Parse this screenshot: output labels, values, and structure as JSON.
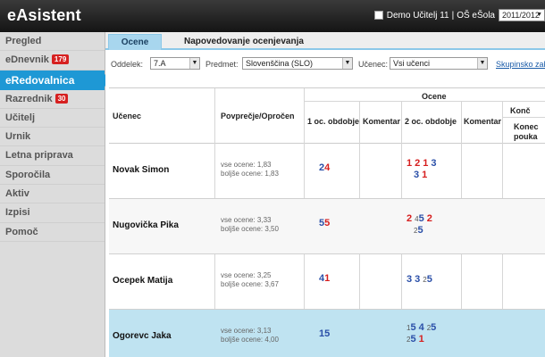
{
  "app": {
    "title": "eAsistent"
  },
  "topbar": {
    "user": "Demo Učitelj 11",
    "separator": "|",
    "school": "OŠ eŠola",
    "year": "2011/2012"
  },
  "sidebar": {
    "items": [
      {
        "label": "Pregled"
      },
      {
        "label": "eDnevnik",
        "badge": "179"
      },
      {
        "label": "eRedovalnica",
        "active": true
      },
      {
        "label": "Razrednik",
        "badge": "30"
      },
      {
        "label": "Učitelj"
      },
      {
        "label": "Urnik"
      },
      {
        "label": "Letna priprava"
      },
      {
        "label": "Sporočila"
      },
      {
        "label": "Aktiv"
      },
      {
        "label": "Izpisi"
      },
      {
        "label": "Pomoč"
      }
    ]
  },
  "tabs": [
    {
      "label": "Ocene"
    },
    {
      "label": "Napovedovanje ocenjevanja"
    }
  ],
  "filters": {
    "oddelek_label": "Oddelek:",
    "oddelek_value": "7.A",
    "predmet_label": "Predmet:",
    "predmet_value": "Slovenščina (SLO)",
    "ucenec_label": "Učenec:",
    "ucenec_value": "Vsi učenci",
    "link": "Skupinsko zak"
  },
  "table": {
    "headers": {
      "student": "Učenec",
      "average": "Povprečje/Opročen",
      "grades": "Ocene",
      "period1": "1 oc. obdobje",
      "comment1": "Komentar",
      "period2": "2 oc. obdobje",
      "comment2": "Komentar",
      "final": "Konč",
      "final_sub": "Konec pouka"
    },
    "rows": [
      {
        "name": "Novak Simon",
        "avg_all": "vse ocene: 1,83",
        "avg_best": "boljše ocene: 1,83"
      },
      {
        "name": "Nugovička Pika",
        "avg_all": "vse ocene: 3,33",
        "avg_best": "boljše ocene: 3,50"
      },
      {
        "name": "Ocepek Matija",
        "avg_all": "vse ocene: 3,25",
        "avg_best": "boljše ocene: 3,67"
      },
      {
        "name": "Ogorevc Jaka",
        "avg_all": "vse ocene: 3,13",
        "avg_best": "boljše ocene: 4,00"
      }
    ]
  },
  "grades": {
    "r0_p1": [
      "2",
      "4"
    ],
    "r0_p2_line1": [
      "1",
      "2",
      "1",
      "3"
    ],
    "r0_p2_line2": [
      "3",
      "1"
    ],
    "r1_p1": [
      "5",
      "5"
    ],
    "r1_p2_line1": [
      "2",
      "4",
      "5",
      "2"
    ],
    "r1_p2_line2": [
      "2",
      "5"
    ],
    "r2_p1": [
      "4",
      "1"
    ],
    "r2_p2_line1": [
      "3",
      "3",
      "2",
      "5"
    ],
    "r3_p1": [
      "1",
      "5"
    ],
    "r3_p2_line1": [
      "1",
      "5",
      "4",
      "2",
      "5"
    ],
    "r3_p2_line2": [
      "2",
      "5",
      "1"
    ]
  },
  "colors": {
    "accent": "#1e98d5",
    "grade_blue": "#2a4fa8",
    "grade_red": "#d61e1e",
    "selected_row": "#bfe3f1"
  }
}
